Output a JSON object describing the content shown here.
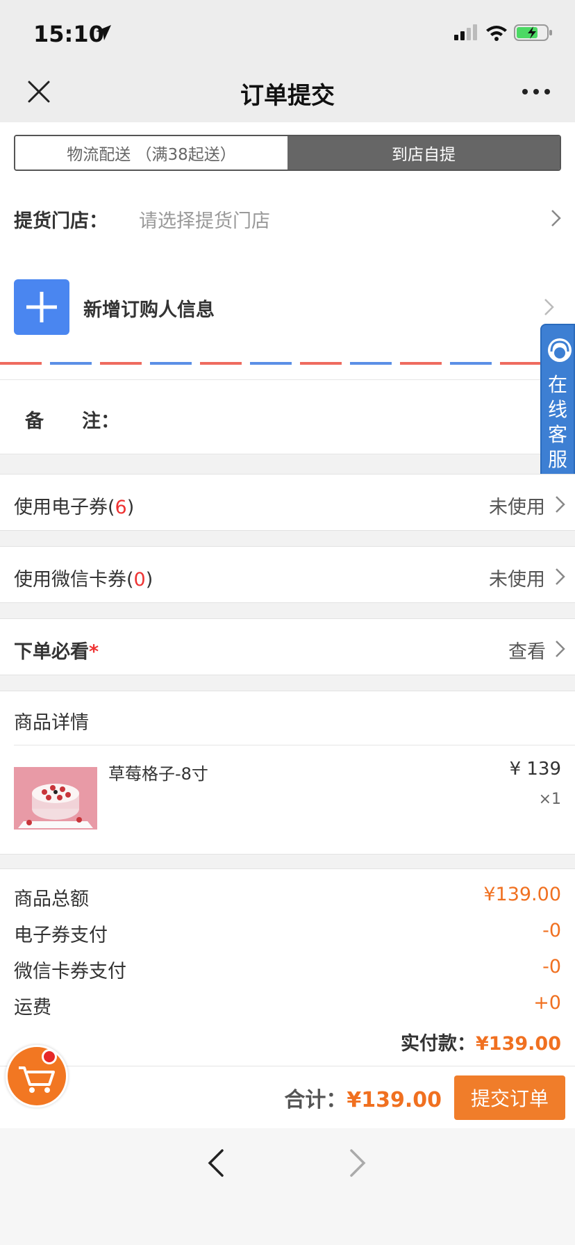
{
  "status_bar": {
    "time": "15:10"
  },
  "nav": {
    "title": "订单提交"
  },
  "delivery_tabs": [
    {
      "label": "物流配送 （满38起送）",
      "active": false
    },
    {
      "label": "到店自提",
      "active": true
    }
  ],
  "pickup": {
    "label": "提货门店：",
    "placeholder": "请选择提货门店"
  },
  "buyer": {
    "add_label": "新增订购人信息"
  },
  "remark": {
    "label_a": "备",
    "label_b": "注："
  },
  "customer_service": {
    "text": "在线客服"
  },
  "coupon": {
    "label": "使用电子券",
    "count": "6",
    "status": "未使用"
  },
  "wechat_card": {
    "label": "使用微信卡券",
    "count": "0",
    "status": "未使用"
  },
  "notice": {
    "label": "下单必看",
    "star": "*",
    "action": "查看"
  },
  "goods": {
    "title": "商品详情",
    "items": [
      {
        "name": "草莓格子-8寸",
        "price": "¥ 139",
        "qty": "×1"
      }
    ]
  },
  "summary": {
    "rows": [
      {
        "label": "商品总额",
        "value": "¥139.00"
      },
      {
        "label": "电子券支付",
        "value": "-0"
      },
      {
        "label": "微信卡券支付",
        "value": "-0"
      },
      {
        "label": "运费",
        "value": "+0"
      }
    ],
    "paid_label": "实付款：",
    "paid_value": "¥139.00"
  },
  "bottom": {
    "total_label": "合计：",
    "total_value": "¥139.00",
    "submit_label": "提交订单"
  },
  "colors": {
    "accent": "#f07d2a",
    "primary_blue": "#4a86f0",
    "price_orange": "#f07020",
    "badge_red": "#e33333"
  }
}
